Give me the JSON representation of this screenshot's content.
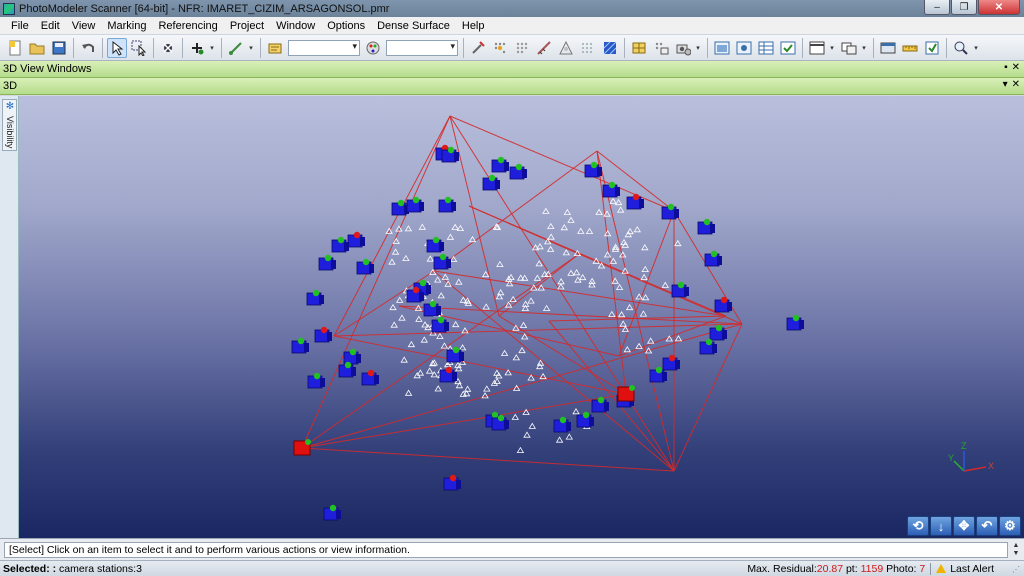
{
  "window": {
    "title": "PhotoModeler Scanner [64-bit] - NFR: IMARET_CIZIM_ARSAGONSOL.pmr",
    "minimize": "‒",
    "restore": "❐",
    "close": "✕"
  },
  "menu": [
    "File",
    "Edit",
    "View",
    "Marking",
    "Referencing",
    "Project",
    "Window",
    "Options",
    "Dense Surface",
    "Help"
  ],
  "toolbar": {
    "combo1_value": "",
    "combo2_value": ""
  },
  "panels": {
    "windows_title": "3D View Windows",
    "view_title": "3D",
    "pin": "▪",
    "dropdown": "▾",
    "visibility_tab": "Visibility"
  },
  "view3d": {
    "background_top": "#b9bfdc",
    "background_bottom": "#1a2762",
    "line_color": "#d42a2a",
    "camera_color": "#1e1edc",
    "axis_labels": {
      "x": "X",
      "y": "Y",
      "z": "Z"
    }
  },
  "nav_buttons": [
    "rotate",
    "down-arrow",
    "pan",
    "undo-view",
    "settings"
  ],
  "command_line": "[Select] Click on an item to select it and to perform various actions or view information.",
  "status": {
    "selected_label": "Selected: :",
    "selected_value": "camera stations:3",
    "residual_label": "Max. Residual:",
    "residual_value": "20.87",
    "pt_label": "pt:",
    "pt_value": "1159",
    "photo_label": "Photo:",
    "photo_value": "7",
    "alert_label": "Last Alert"
  }
}
